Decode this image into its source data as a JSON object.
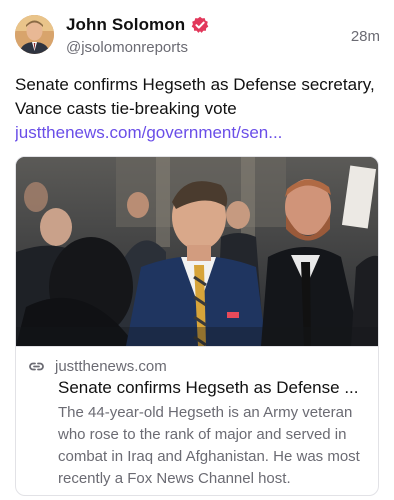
{
  "post": {
    "author": {
      "display_name": "John Solomon",
      "handle": "@jsolomonreports",
      "verified": true,
      "avatar_icon": "avatar"
    },
    "timestamp": "28m",
    "text": "Senate confirms Hegseth as Defense secretary, Vance casts tie-breaking vote",
    "link_text": "justthenews.com/government/sen..."
  },
  "card": {
    "domain": "justthenews.com",
    "title": "Senate confirms Hegseth as Defense ...",
    "description": "The 44-year-old Hegseth is an Army veteran who rose to the rank of major and served in combat in Iraq and Afghanistan. He was most recently a Fox News Channel host.",
    "image_icon": "news-photo"
  },
  "colors": {
    "accent": "#6a4ee8",
    "verified_badge": "#e2385b",
    "muted_text": "#6b6b73",
    "border": "#e2e2e6"
  }
}
